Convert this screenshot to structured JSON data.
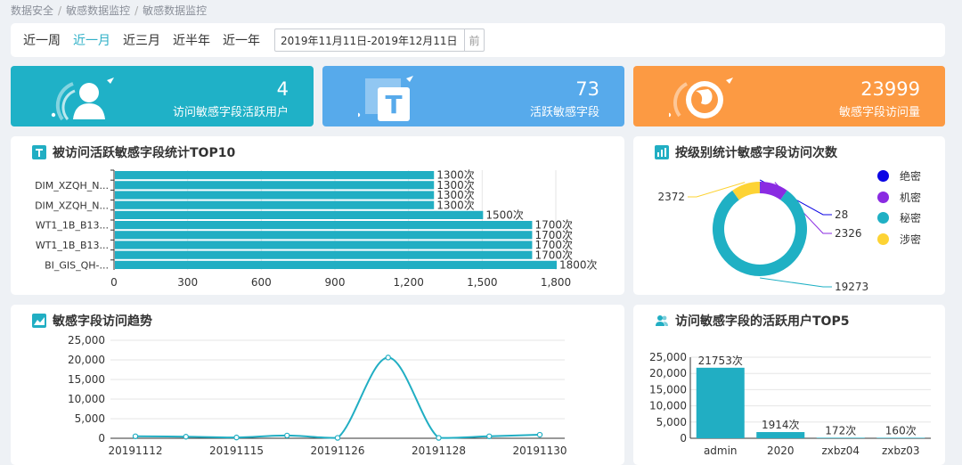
{
  "breadcrumb": [
    "数据安全",
    "敏感数据监控",
    "敏感数据监控"
  ],
  "filter": {
    "periods": [
      "近一周",
      "近一月",
      "近三月",
      "近半年",
      "近一年"
    ],
    "active": "近一月",
    "date_range": "2019年11月11日-2019年12月11日",
    "calendar_glyph": "前"
  },
  "stats": [
    {
      "value": "4",
      "label": "访问敏感字段活跃用户",
      "color": "#1fb1c7",
      "icon": "user-icon"
    },
    {
      "value": "73",
      "label": "活跃敏感字段",
      "color": "#57aaeb",
      "icon": "text-field-icon"
    },
    {
      "value": "23999",
      "label": "敏感字段访问量",
      "color": "#fc9a43",
      "icon": "globe-icon"
    }
  ],
  "panels": {
    "top10_title": "被访问活跃敏感字段统计TOP10",
    "level_title": "按级别统计敏感字段访问次数",
    "trend_title": "敏感字段访问趋势",
    "users_title": "访问敏感字段的活跃用户TOP5"
  },
  "colors": {
    "teal": "#21aec3",
    "green_bar": "#23aec3"
  },
  "chart_data": [
    {
      "id": "top10",
      "type": "bar",
      "orientation": "horizontal",
      "categories": [
        "BI_GIS_QH-...",
        "",
        "WT1_1B_B13...",
        "",
        "WT1_1B_B13...",
        "",
        "DIM_XZQH_N...",
        "",
        "DIM_XZQH_N...",
        ""
      ],
      "values": [
        1800,
        1700,
        1700,
        1700,
        1700,
        1500,
        1300,
        1300,
        1300,
        1300
      ],
      "value_suffix": "次",
      "xlim": [
        0,
        1800
      ],
      "xticks": [
        "0",
        "300",
        "600",
        "900",
        "1,200",
        "1,500",
        "1,800"
      ]
    },
    {
      "id": "levels",
      "type": "pie",
      "labels": [
        "绝密",
        "机密",
        "秘密",
        "涉密"
      ],
      "values": [
        28,
        2326,
        19273,
        2372
      ],
      "colors": [
        "#0c06e4",
        "#8a2be2",
        "#1fb0c4",
        "#fdd334"
      ]
    },
    {
      "id": "trend",
      "type": "line",
      "x": [
        "20191112",
        "20191115",
        "20191126",
        "20191128",
        "20191130"
      ],
      "points": [
        {
          "x": 0,
          "y": 500
        },
        {
          "x": 1,
          "y": 400
        },
        {
          "x": 2,
          "y": 200
        },
        {
          "x": 3,
          "y": 700
        },
        {
          "x": 4,
          "y": 100
        },
        {
          "x": 5,
          "y": 20600
        },
        {
          "x": 6,
          "y": 100
        },
        {
          "x": 7,
          "y": 500
        },
        {
          "x": 8,
          "y": 900
        }
      ],
      "xtick_labels": [
        {
          "i": 0,
          "label": "20191112"
        },
        {
          "i": 2,
          "label": "20191115"
        },
        {
          "i": 4,
          "label": "20191126"
        },
        {
          "i": 6,
          "label": "20191128"
        },
        {
          "i": 8,
          "label": "20191130"
        }
      ],
      "ylim": [
        0,
        25000
      ],
      "yticks": [
        "0",
        "5,000",
        "10,000",
        "15,000",
        "20,000",
        "25,000"
      ]
    },
    {
      "id": "users",
      "type": "bar",
      "categories": [
        "admin",
        "2020",
        "zxbz04",
        "zxbz03"
      ],
      "values": [
        21753,
        1914,
        172,
        160
      ],
      "value_suffix": "次",
      "ylim": [
        0,
        25000
      ],
      "yticks": [
        "0",
        "5,000",
        "10,000",
        "15,000",
        "20,000",
        "25,000"
      ]
    }
  ]
}
